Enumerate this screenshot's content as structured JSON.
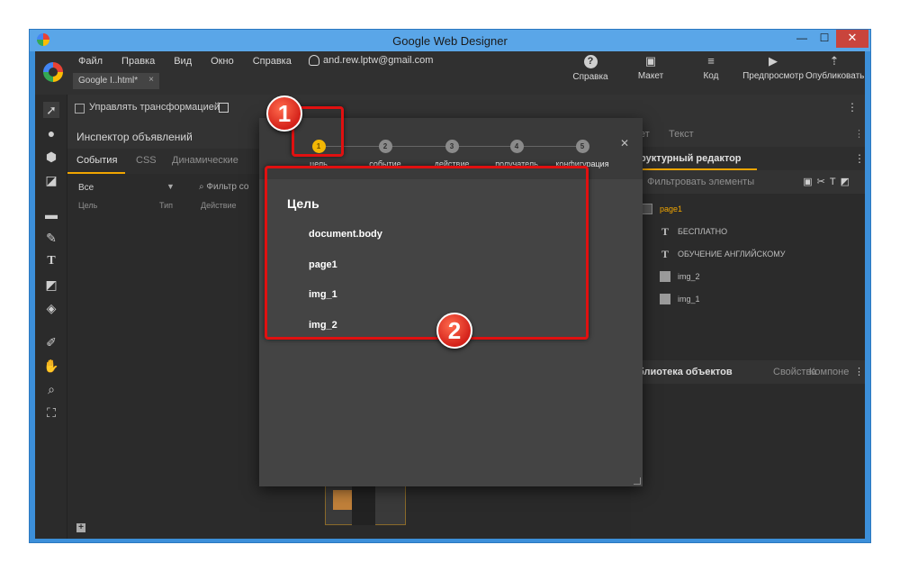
{
  "window": {
    "title": "Google Web Designer",
    "controls": {
      "minimize": "—",
      "maximize": "☐",
      "close": "✕"
    }
  },
  "menu": [
    "Файл",
    "Правка",
    "Вид",
    "Окно",
    "Справка"
  ],
  "account": "and.rew.lptw@gmail.com",
  "file_tab": {
    "label": "Google I..html*",
    "close": "×"
  },
  "toolbar": {
    "help": "Справка",
    "layout": "Макет",
    "code": "Код",
    "preview": "Предпросмотр",
    "publish": "Опубликовать"
  },
  "options_bar": {
    "transform_label": "Управлять трансформацией"
  },
  "inspector": {
    "title": "Инспектор объявлений",
    "tabs": [
      "События",
      "CSS",
      "Динамические"
    ],
    "filter_all": "Все",
    "filter_placeholder": "Фильтр со",
    "columns": [
      "Цель",
      "Тип",
      "Действие"
    ],
    "add": "+"
  },
  "right_panel": {
    "top_tabs": [
      "ет",
      "Текст"
    ],
    "structure_title": "руктурный редактор",
    "filter_label": "Фильтровать элементы",
    "tree": [
      {
        "label": "page1",
        "icon": "page-icon",
        "selected": true
      },
      {
        "label": "БЕСПЛАТНО",
        "icon": "text-icon",
        "selected": false
      },
      {
        "label": "ОБУЧЕНИЕ АНГЛИЙСКОМУ",
        "icon": "text-icon",
        "selected": false
      },
      {
        "label": "img_2",
        "icon": "image-icon",
        "selected": false
      },
      {
        "label": "img_1",
        "icon": "image-icon",
        "selected": false
      }
    ],
    "library_tabs": [
      "блиотека объектов",
      "Свойства",
      "Компоне"
    ]
  },
  "dialog": {
    "steps": [
      {
        "num": "1",
        "label": "цель",
        "active": true
      },
      {
        "num": "2",
        "label": "событие",
        "active": false
      },
      {
        "num": "3",
        "label": "действие",
        "active": false
      },
      {
        "num": "4",
        "label": "получатель",
        "active": false
      },
      {
        "num": "5",
        "label": "конфигурация",
        "active": false
      }
    ],
    "close": "✕",
    "heading": "Цель",
    "targets": [
      "document.body",
      "page1",
      "img_1",
      "img_2"
    ]
  },
  "annotations": {
    "badge1": "1",
    "badge2": "2",
    "color": "#e01010"
  },
  "colors": {
    "accent": "#f0a500",
    "step_active": "#f2b705",
    "window_frame": "#3c8fd9",
    "close_button": "#c9443c"
  }
}
